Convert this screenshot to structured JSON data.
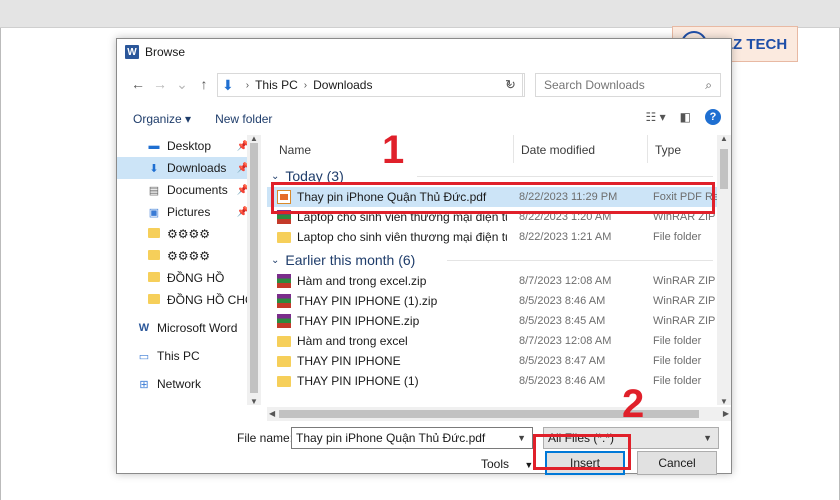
{
  "window": {
    "title": "Browse"
  },
  "nav": {
    "back": "←",
    "forward": "→",
    "recent": "⌄",
    "up": "↑",
    "refresh": "↻"
  },
  "address": {
    "parts": [
      "This PC",
      "Downloads"
    ]
  },
  "search": {
    "placeholder": "Search Downloads"
  },
  "toolbar": {
    "organize": "Organize ▾",
    "new_folder": "New folder"
  },
  "sidebar": {
    "items": [
      {
        "label": "Desktop",
        "pinned": true,
        "icon": "desktop-icon"
      },
      {
        "label": "Downloads",
        "pinned": true,
        "icon": "download-icon",
        "selected": true
      },
      {
        "label": "Documents",
        "pinned": true,
        "icon": "documents-icon"
      },
      {
        "label": "Pictures",
        "pinned": true,
        "icon": "pictures-icon"
      },
      {
        "label": "⚙⚙⚙⚙",
        "icon": "folder-icon"
      },
      {
        "label": "⚙⚙⚙⚙",
        "icon": "folder-icon"
      },
      {
        "label": "ĐỒNG HỒ",
        "icon": "folder-icon"
      },
      {
        "label": "ĐỒNG HỒ CHO",
        "icon": "folder-icon"
      }
    ],
    "roots": [
      {
        "label": "Microsoft Word",
        "icon": "word-icon"
      },
      {
        "label": "This PC",
        "icon": "computer-icon"
      },
      {
        "label": "Network",
        "icon": "network-icon"
      }
    ]
  },
  "columns": {
    "name": "Name",
    "date": "Date modified",
    "type": "Type"
  },
  "groups": [
    {
      "label": "Today (3)",
      "rows": [
        {
          "name": "Thay pin iPhone Quận Thủ Đức.pdf",
          "date": "8/22/2023 11:29 PM",
          "type": "Foxit PDF Re",
          "kind": "pdf",
          "selected": true
        },
        {
          "name": "Laptop cho sinh viên thương mại điện tử",
          "date": "8/22/2023 1:20 AM",
          "type": "WinRAR ZIP a",
          "kind": "zip"
        },
        {
          "name": "Laptop cho sinh viên thương mại điện tử",
          "date": "8/22/2023 1:21 AM",
          "type": "File folder",
          "kind": "folder"
        }
      ]
    },
    {
      "label": "Earlier this month (6)",
      "rows": [
        {
          "name": "Hàm and trong excel.zip",
          "date": "8/7/2023 12:08 AM",
          "type": "WinRAR ZIP a",
          "kind": "zip"
        },
        {
          "name": "THAY PIN IPHONE (1).zip",
          "date": "8/5/2023 8:46 AM",
          "type": "WinRAR ZIP a",
          "kind": "zip"
        },
        {
          "name": "THAY PIN IPHONE.zip",
          "date": "8/5/2023 8:45 AM",
          "type": "WinRAR ZIP a",
          "kind": "zip"
        },
        {
          "name": "Hàm and trong excel",
          "date": "8/7/2023 12:08 AM",
          "type": "File folder",
          "kind": "folder"
        },
        {
          "name": "THAY PIN IPHONE",
          "date": "8/5/2023 8:47 AM",
          "type": "File folder",
          "kind": "folder"
        },
        {
          "name": "THAY PIN IPHONE (1)",
          "date": "8/5/2023 8:46 AM",
          "type": "File folder",
          "kind": "folder"
        }
      ]
    }
  ],
  "footer": {
    "file_name_label": "File name:",
    "file_name_value": "Thay pin iPhone Quận Thủ Đức.pdf",
    "filter": "All Files (*.*)",
    "tools": "Tools",
    "insert": "Insert",
    "cancel": "Cancel"
  },
  "annotations": {
    "step1": "1",
    "step2": "2"
  },
  "logo": {
    "text": "DLZ TECH",
    "mark": "D"
  },
  "colors": {
    "annotation": "#e0202a",
    "selection": "#cce4f7",
    "accent": "#1f6fd1"
  }
}
